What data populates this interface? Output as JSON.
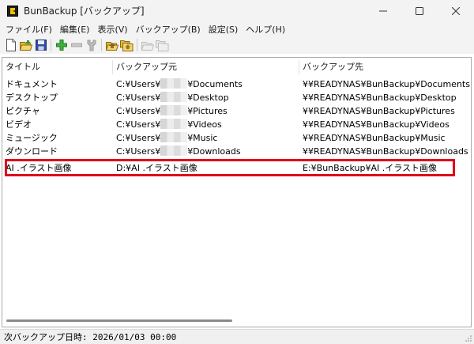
{
  "window": {
    "title": "BunBackup [バックアップ]",
    "controls": [
      "minimize",
      "maximize",
      "close"
    ]
  },
  "menu": [
    "ファイル(F)",
    "編集(E)",
    "表示(V)",
    "バックアップ(B)",
    "設定(S)",
    "ヘルプ(H)"
  ],
  "toolbar_icons": [
    "new-file-icon",
    "open-folder-icon",
    "save-icon",
    "add-icon",
    "remove-icon",
    "properties-icon",
    "backup-icon",
    "backup-all-icon",
    "restore-icon",
    "restore-all-icon"
  ],
  "list": {
    "headers": [
      "タイトル",
      "バックアップ元",
      "バックアップ先"
    ],
    "rows": [
      {
        "title": "ドキュメント",
        "src_prefix": "C:¥Users¥",
        "src_suffix": "¥Documents",
        "dest": "¥¥READYNAS¥BunBackup¥Documents"
      },
      {
        "title": "デスクトップ",
        "src_prefix": "C:¥Users¥",
        "src_suffix": "¥Desktop",
        "dest": "¥¥READYNAS¥BunBackup¥Desktop"
      },
      {
        "title": "ピクチャ",
        "src_prefix": "C:¥Users¥",
        "src_suffix": "¥Pictures",
        "dest": "¥¥READYNAS¥BunBackup¥Pictures"
      },
      {
        "title": "ビデオ",
        "src_prefix": "C:¥Users¥",
        "src_suffix": "¥Videos",
        "dest": "¥¥READYNAS¥BunBackup¥Videos"
      },
      {
        "title": "ミュージック",
        "src_prefix": "C:¥Users¥",
        "src_suffix": "¥Music",
        "dest": "¥¥READYNAS¥BunBackup¥Music"
      },
      {
        "title": "ダウンロード",
        "src_prefix": "C:¥Users¥",
        "src_suffix": "¥Downloads",
        "dest": "¥¥READYNAS¥BunBackup¥Downloads"
      },
      {
        "title": "AI .イラスト画像",
        "src_prefix": "D:¥AI .イラスト画像",
        "src_suffix": "",
        "dest": "E:¥BunBackup¥AI .イラスト画像"
      }
    ],
    "highlighted_row_index": 6,
    "highlight_color": "#e0001b"
  },
  "status": {
    "text": "次バックアップ日時: 2026/01/03 00:00"
  }
}
